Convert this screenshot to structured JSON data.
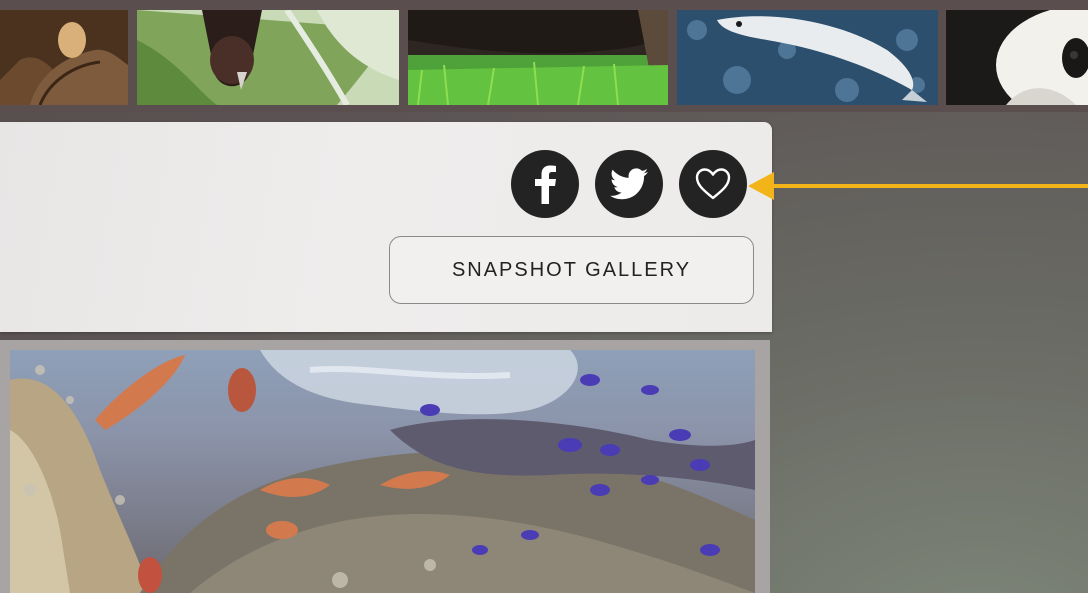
{
  "gallery": {
    "thumbnails": [
      {
        "name": "elephant"
      },
      {
        "name": "bat"
      },
      {
        "name": "grass-animal"
      },
      {
        "name": "fish"
      },
      {
        "name": "panda"
      }
    ]
  },
  "share": {
    "facebook_icon": "facebook-icon",
    "twitter_icon": "twitter-icon",
    "favorite_icon": "heart-icon"
  },
  "snapshot_button": {
    "label": "SNAPSHOT GALLERY"
  },
  "live_cam": {
    "scene": "aquarium"
  },
  "colors": {
    "icon_bg": "#232323",
    "arrow": "#f2b418",
    "panel": "#ecebea"
  }
}
